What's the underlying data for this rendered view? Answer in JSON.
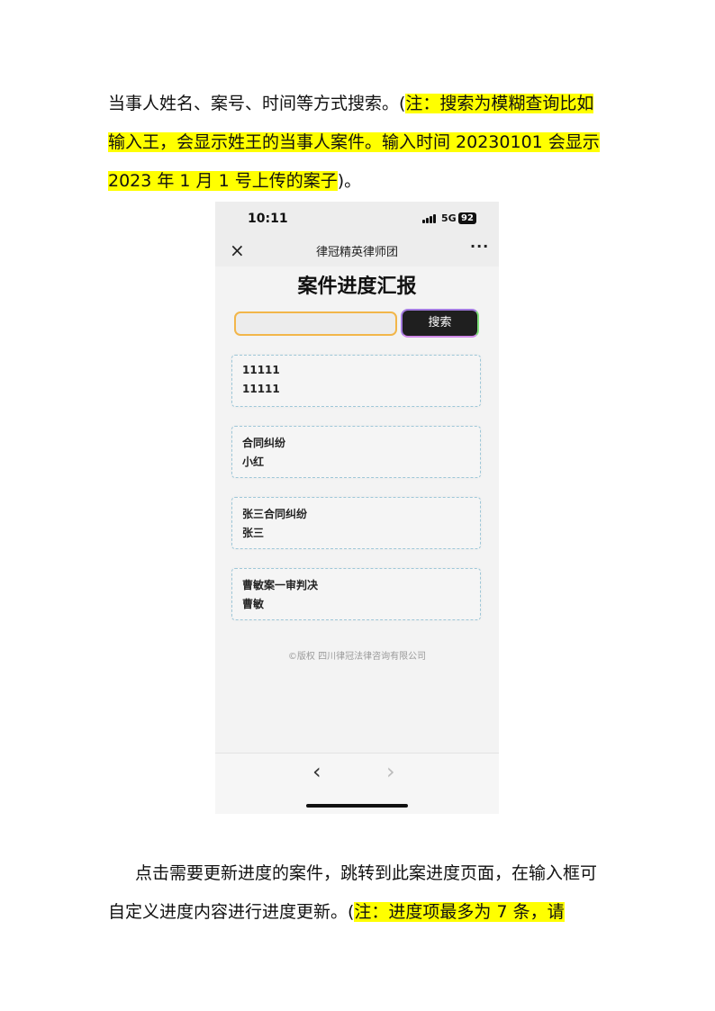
{
  "doc": {
    "para_top": {
      "plain": "当事人姓名、案号、时间等方式搜索。(",
      "highlight": "注：搜索为模糊查询比如输入王，会显示姓王的当事人案件。输入时间 20230101 会显示 2023 年 1 月 1 号上传的案子",
      "tail": ")。"
    },
    "para_bottom": {
      "plain": "点击需要更新进度的案件，跳转到此案进度页面，在输入框可自定义进度内容进行进度更新。(",
      "highlight": "注：进度项最多为 7 条，请"
    }
  },
  "phone": {
    "status": {
      "time": "10:11",
      "network": "5G",
      "battery": "92"
    },
    "nav": {
      "close_glyph": "×",
      "title": "律冠精英律师团",
      "more_glyph": "···"
    },
    "page_title": "案件进度汇报",
    "search": {
      "placeholder": "",
      "button": "搜索",
      "button_border_colors": [
        "#a37be0",
        "#7fe07a"
      ]
    },
    "cases": [
      {
        "title": "11111",
        "client": "11111"
      },
      {
        "title": "合同纠纷",
        "client": "小红"
      },
      {
        "title": "张三合同纠纷",
        "client": "张三"
      },
      {
        "title": "曹敏案一审判决",
        "client": "曹敏"
      }
    ],
    "copyright": "©版权 四川律冠法律咨询有限公司",
    "bottom_nav": {
      "back_glyph": "‹",
      "forward_glyph": "›"
    }
  },
  "colors": {
    "highlight": "#ffff00",
    "input_border": "#f2b64a",
    "card_border": "#9ec7d8"
  },
  "icons": [
    "close-icon",
    "more-icon",
    "signal-icon",
    "battery-icon",
    "back-arrow-icon",
    "forward-arrow-icon"
  ]
}
